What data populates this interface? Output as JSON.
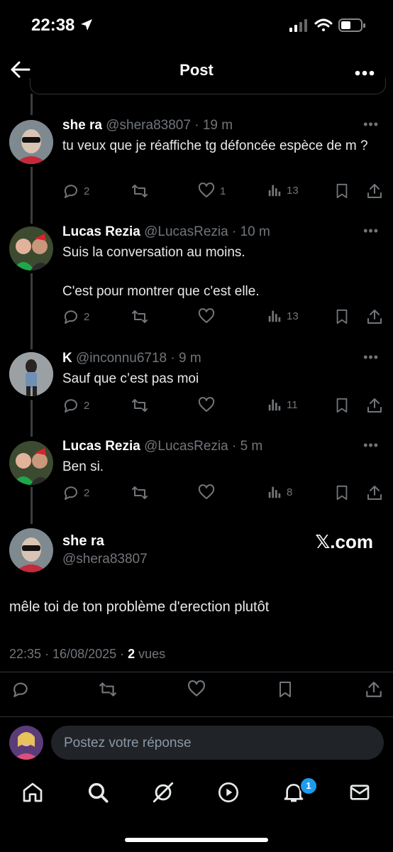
{
  "status_bar": {
    "time": "22:38"
  },
  "header": {
    "title": "Post"
  },
  "replies": [
    {
      "name": "she ra",
      "handle": "@shera83807",
      "age": "19 m",
      "text": "tu veux que je réaffiche tg défoncée espèce de m ?",
      "replies": "2",
      "reposts": "",
      "likes": "1",
      "views": "13"
    },
    {
      "name": "Lucas Rezia",
      "handle": "@LucasRezia",
      "age": "10 m",
      "text": "Suis la conversation au moins.",
      "text2": "C'est pour montrer que c'est elle.",
      "replies": "2",
      "reposts": "",
      "likes": "",
      "views": "13"
    },
    {
      "name": "K",
      "handle": "@inconnu6718",
      "age": "9 m",
      "text": "Sauf que c’est pas moi",
      "replies": "2",
      "reposts": "",
      "likes": "",
      "views": "11"
    },
    {
      "name": "Lucas Rezia",
      "handle": "@LucasRezia",
      "age": "5 m",
      "text": "Ben si.",
      "replies": "2",
      "reposts": "",
      "likes": "",
      "views": "8"
    }
  ],
  "main_post": {
    "name": "she ra",
    "handle": "@shera83807",
    "watermark": "𝕏.com",
    "text": "mêle toi de ton problème d'erection plutôt",
    "timestamp": "22:35 · 16/08/2025 · ",
    "views_count": "2",
    "views_label": " vues"
  },
  "compose": {
    "placeholder": "Postez votre réponse"
  },
  "nav": {
    "notifications_badge": "1"
  },
  "colors": {
    "background": "#000000",
    "muted": "#71767b",
    "accent": "#1d9bf0"
  }
}
